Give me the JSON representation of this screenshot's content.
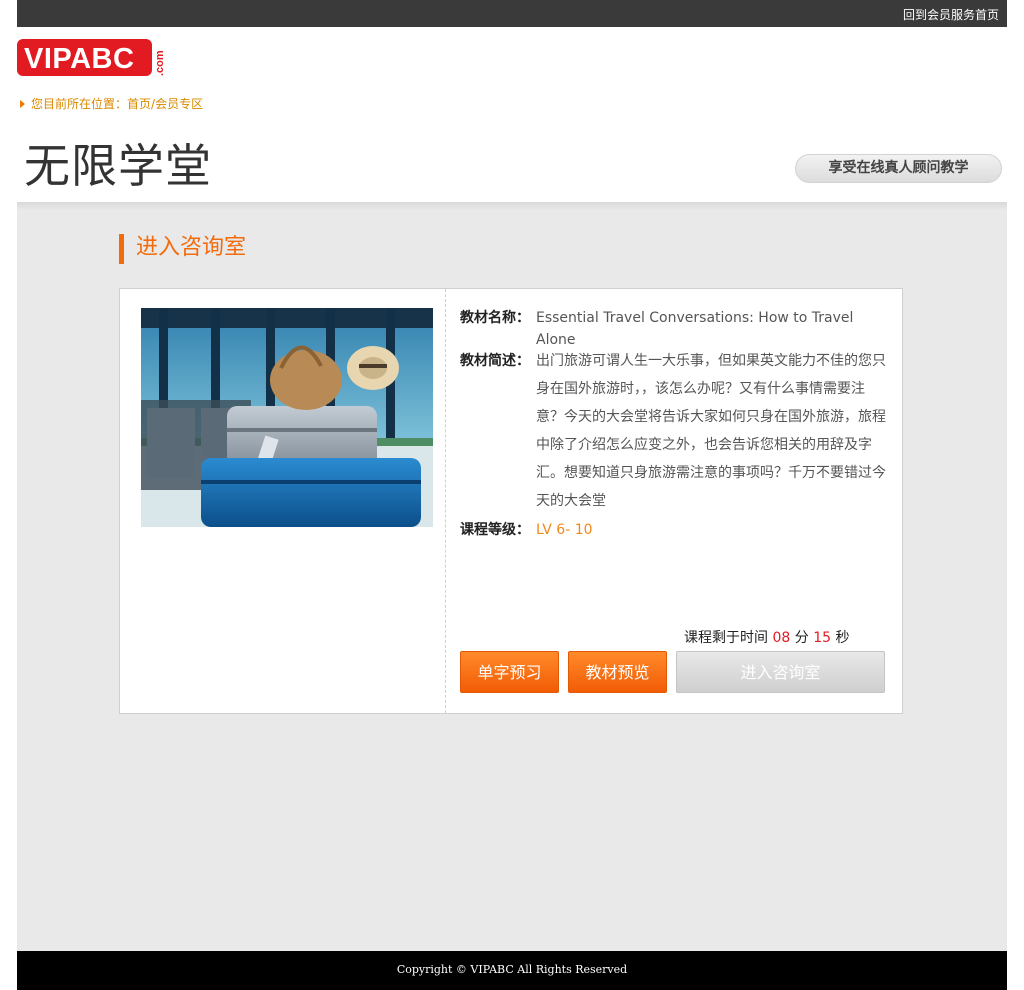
{
  "topbar": {
    "link": "回到会员服务首页"
  },
  "logo": {
    "text": "VIPABC",
    "suffix": ".com"
  },
  "breadcrumb": {
    "prefix": "您目前所在位置：",
    "home": "首页",
    "separator": " /",
    "current": "会员专区"
  },
  "header": {
    "title": "无限学堂",
    "slogan": "享受在线真人顾问教学"
  },
  "section": {
    "title": "进入咨询室"
  },
  "course": {
    "title_label": "教材名称：",
    "title_value": "Essential Travel Conversations: How to Travel Alone",
    "desc_label": "教材简述：",
    "desc_value": "出门旅游可谓人生一大乐事，但如果英文能力不佳的您只身在国外旅游时，，该怎么办呢？又有什么事情需要注意？今天的大会堂将告诉大家如何只身在国外旅游，旅程中除了介绍怎么应变之外，也会告诉您相关的用辞及字汇。想要知道只身旅游需注意的事项吗？千万不要错过今天的大会堂",
    "level_label": "课程等级：",
    "level_value": "LV 6- 10"
  },
  "timer": {
    "prefix": "课程剩于时间 ",
    "minutes": "08",
    "min_unit": " 分 ",
    "seconds": "15",
    "sec_unit": " 秒"
  },
  "buttons": {
    "vocab": "单字预习",
    "material": "教材预览",
    "enter": "进入咨询室"
  },
  "footer": {
    "copyright": "Copyright © VIPABC All Rights Reserved"
  },
  "colors": {
    "brand_red": "#e21b22",
    "accent_orange": "#f26c0d",
    "level_orange": "#f08a1a"
  }
}
